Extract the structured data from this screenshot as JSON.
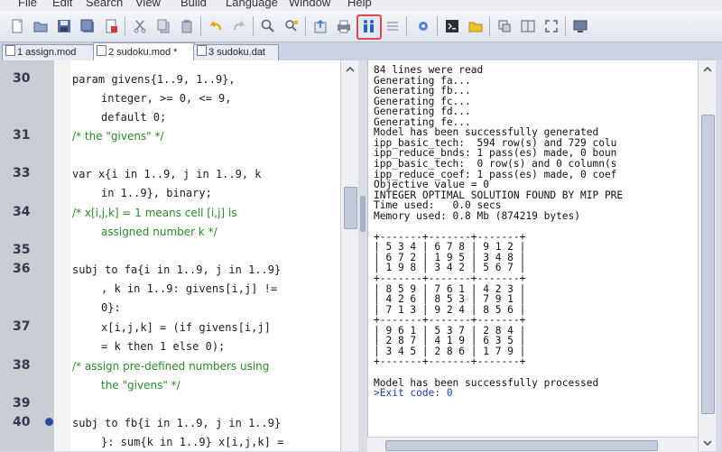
{
  "menu": [
    "File",
    "Edit",
    "Search",
    "View",
    "Build",
    "Language",
    "Window",
    "Help"
  ],
  "toolbar_icons": [
    "new-file-icon",
    "open-folder-icon",
    "save-icon",
    "save-all-icon",
    "close-file-icon",
    "cut-icon",
    "copy-icon",
    "paste-icon",
    "undo-icon",
    "redo-icon",
    "find-icon",
    "find-replace-icon",
    "export-icon",
    "print-icon",
    "run-model-icon",
    "grid-icon",
    "settings-icon",
    "terminal-icon",
    "folder-icon",
    "window-icon",
    "split-view-icon",
    "fullscreen-icon",
    "monitor-icon"
  ],
  "tabs": [
    {
      "label": "1 assign.mod"
    },
    {
      "label": "2 sudoku.mod *"
    },
    {
      "label": "3 sudoku.dat"
    }
  ],
  "editor": {
    "line_numbers": [
      "30",
      "31",
      "33",
      "34",
      "35",
      "36",
      "37",
      "38",
      "39",
      "40"
    ],
    "lines": [
      "param givens{1..9, 1..9},",
      "integer, >= 0, <= 9,",
      "default 0;",
      "var x{i in 1..9, j in 1..9, k",
      "in 1..9}, binary;",
      "subj to fa{i in 1..9, j in 1..9}",
      ", k in 1..9: givens[i,j] !=",
      "0}:",
      "x[i,j,k] = (if givens[i,j]",
      "= k then 1 else 0);",
      "subj to fb{i in 1..9, j in 1..9}",
      "}: sum{k in 1..9} x[i,j,k] ="
    ],
    "comments": [
      "/* the \"givens\" */",
      "/* x[i,j,k] = 1 means cell [i,j] is",
      "assigned number k */",
      "/* assign pre-defined numbers using",
      "the \"givens\" */"
    ]
  },
  "output": {
    "lines": [
      "84 lines were read",
      "Generating fa...",
      "Generating fb...",
      "Generating fc...",
      "Generating fd...",
      "Generating fe...",
      "Model has been successfully generated",
      "ipp_basic_tech:  594 row(s) and 729 colu",
      "ipp_reduce_bnds: 1 pass(es) made, 0 boun",
      "ipp_basic_tech:  0 row(s) and 0 column(s",
      "ipp_reduce_coef: 1 pass(es) made, 0 coef",
      "Objective value = 0",
      "INTEGER OPTIMAL SOLUTION FOUND BY MIP PRE",
      "Time used:   0.0 secs",
      "Memory used: 0.8 Mb (874219 bytes)",
      "",
      "+-------+-------+-------+",
      "| 5 3 4 | 6 7 8 | 9 1 2 |",
      "| 6 7 2 | 1 9 5 | 3 4 8 |",
      "| 1 9 8 | 3 4 2 | 5 6 7 |",
      "+-------+-------+-------+",
      "| 8 5 9 | 7 6 1 | 4 2 3 |",
      "| 4 2 6 | 8 5 3 | 7 9 1 |",
      "| 7 1 3 | 9 2 4 | 8 5 6 |",
      "+-------+-------+-------+",
      "| 9 6 1 | 5 3 7 | 2 8 4 |",
      "| 2 8 7 | 4 1 9 | 6 3 5 |",
      "| 3 4 5 | 2 8 6 | 1 7 9 |",
      "+-------+-------+-------+",
      "",
      "Model has been successfully processed",
      ">Exit code: 0"
    ]
  }
}
